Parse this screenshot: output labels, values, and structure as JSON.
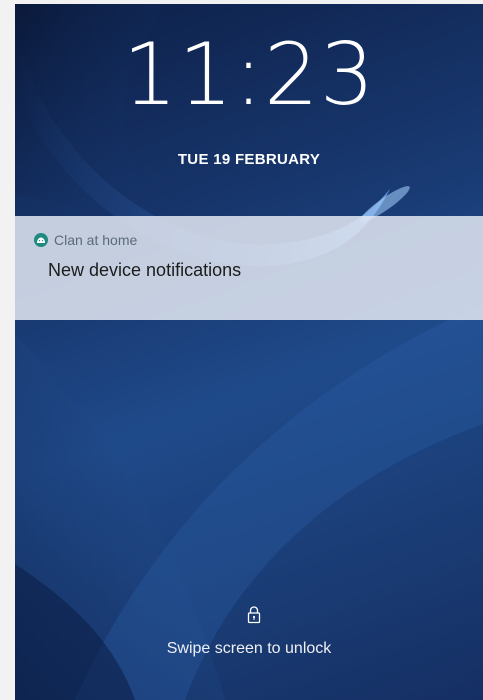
{
  "lockscreen": {
    "time": "11:23",
    "date": "TUE 19 FEBRUARY",
    "unlock_hint": "Swipe screen to unlock",
    "lock_icon": "lock-icon"
  },
  "notification": {
    "app_name": "Clan at home",
    "app_icon": "android-icon",
    "title": "New device notifications"
  },
  "colors": {
    "notification_bg": "#e2e8f2",
    "app_icon_bg": "#1f8a80",
    "wallpaper_dark": "#0d1f47",
    "wallpaper_mid": "#1f4a8a"
  }
}
